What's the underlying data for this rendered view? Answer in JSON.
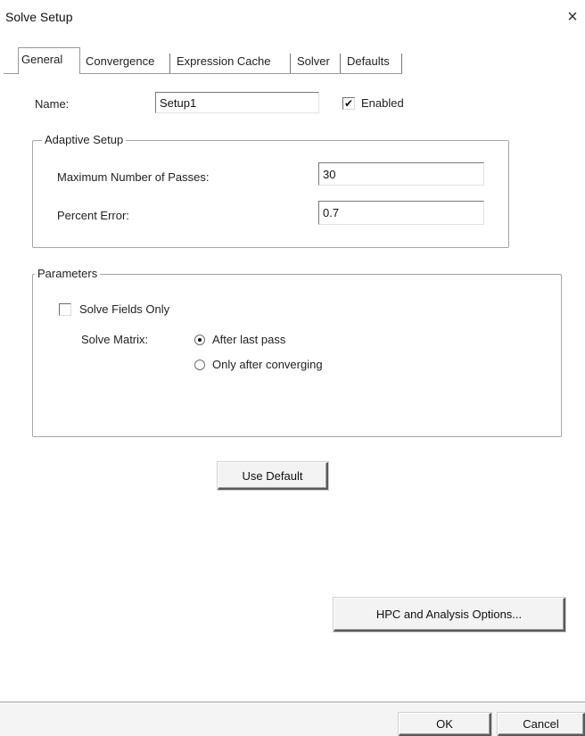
{
  "window": {
    "title": "Solve Setup",
    "close_glyph": "×"
  },
  "tabs": [
    {
      "label": "General",
      "active": true
    },
    {
      "label": "Convergence",
      "active": false
    },
    {
      "label": "Expression Cache",
      "active": false
    },
    {
      "label": "Solver",
      "active": false
    },
    {
      "label": "Defaults",
      "active": false
    }
  ],
  "general": {
    "name_label": "Name:",
    "name_value": "Setup1",
    "enabled_label": "Enabled",
    "enabled_checked": true
  },
  "adaptive_setup": {
    "title": "Adaptive Setup",
    "max_passes_label": "Maximum Number of Passes:",
    "max_passes_value": "30",
    "percent_error_label": "Percent Error:",
    "percent_error_value": "0.7"
  },
  "parameters": {
    "title": "Parameters",
    "solve_fields_only_label": "Solve Fields Only",
    "solve_fields_only_checked": false,
    "solve_matrix_label": "Solve Matrix:",
    "options": [
      {
        "label": "After last pass",
        "selected": true
      },
      {
        "label": "Only after converging",
        "selected": false
      }
    ]
  },
  "buttons": {
    "use_default": "Use Default",
    "hpc": "HPC and Analysis Options...",
    "ok": "OK",
    "cancel": "Cancel"
  },
  "icons": {
    "checkmark": "✔"
  }
}
